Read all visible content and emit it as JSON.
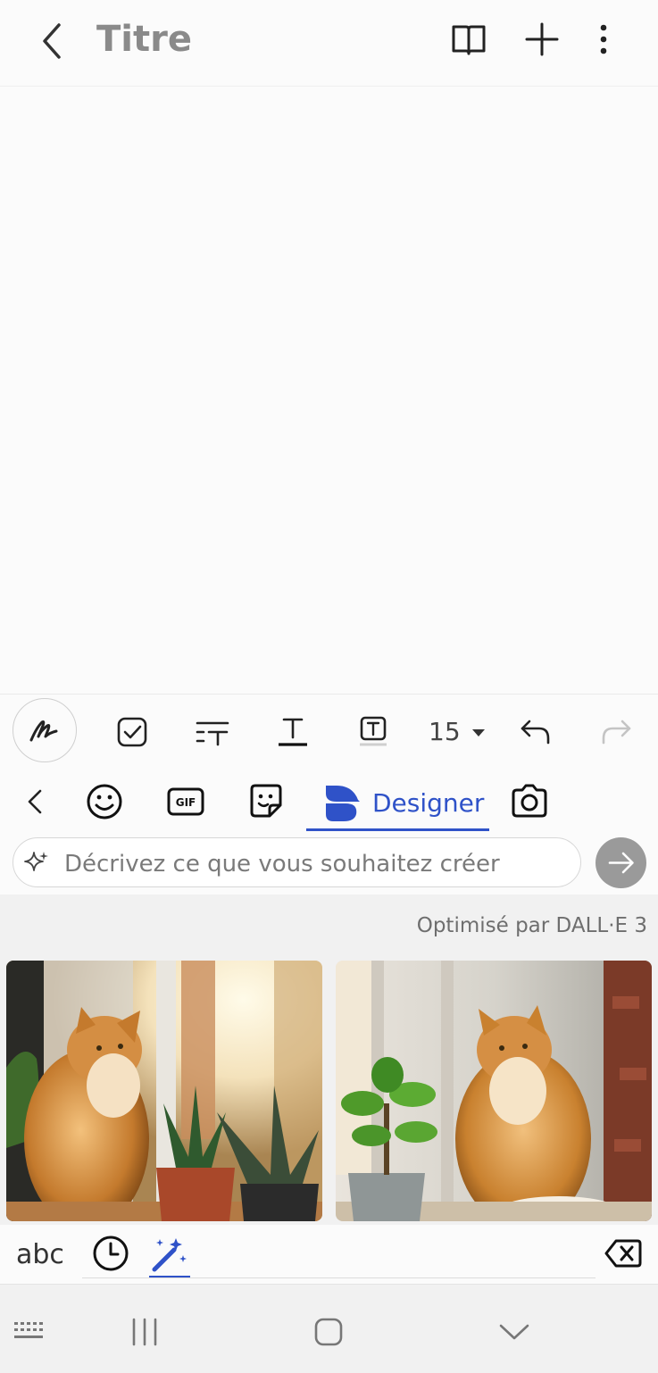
{
  "app_bar": {
    "title": "Titre",
    "back_icon": "chevron-left-icon",
    "reader_icon": "book-icon",
    "add_icon": "plus-icon",
    "more_icon": "more-vertical-icon"
  },
  "format_toolbar": {
    "handwriting_icon": "pen-icon",
    "checkbox_icon": "checkbox-icon",
    "text_style_icon": "text-style-icon",
    "text_color_icon": "text-underline-icon",
    "text_bg_icon": "text-box-icon",
    "font_size": "15",
    "undo_icon": "undo-icon",
    "redo_icon": "redo-icon"
  },
  "keyboard": {
    "tabs": {
      "back_icon": "chevron-left-icon",
      "emoji_icon": "emoji-icon",
      "gif_label": "GIF",
      "sticker_icon": "sticker-icon",
      "designer_label": "Designer",
      "camera_icon": "camera-icon"
    },
    "prompt": {
      "placeholder": "Décrivez ce que vous souhaitez créer",
      "send_icon": "arrow-right-icon"
    },
    "credit": "Optimisé par DALL·E 3",
    "images": [
      {
        "name": "cat-image-1"
      },
      {
        "name": "cat-image-2"
      }
    ],
    "bottom_row": {
      "abc_label": "abc",
      "recent_icon": "clock-icon",
      "magic_icon": "magic-wand-icon",
      "delete_icon": "backspace-icon"
    }
  },
  "navigation_bar": {
    "keyboard_icon": "keyboard-icon",
    "recents_icon": "recents-icon",
    "home_icon": "home-icon",
    "hide_keyboard_icon": "chevron-down-icon"
  },
  "colors": {
    "accent": "#2f52c8",
    "title_gray": "#8a8a8a",
    "send_button": "#9a9a9a"
  }
}
